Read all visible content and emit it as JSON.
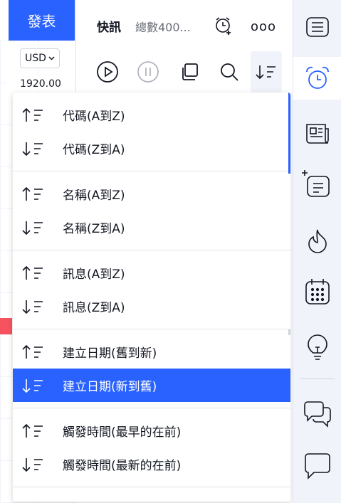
{
  "left": {
    "publish_label": "發表",
    "currency": "USD",
    "price": "1920.00"
  },
  "news": {
    "title": "快訊",
    "count": "總數400...",
    "more_label": "ooo"
  },
  "sort_menu": {
    "groups": [
      [
        {
          "label": "代碼(A到Z)",
          "direction": "asc"
        },
        {
          "label": "代碼(Z到A)",
          "direction": "desc"
        }
      ],
      [
        {
          "label": "名稱(A到Z)",
          "direction": "asc"
        },
        {
          "label": "名稱(Z到A)",
          "direction": "desc"
        }
      ],
      [
        {
          "label": "訊息(A到Z)",
          "direction": "asc"
        },
        {
          "label": "訊息(Z到A)",
          "direction": "desc"
        }
      ],
      [
        {
          "label": "建立日期(舊到新)",
          "direction": "asc"
        },
        {
          "label": "建立日期(新到舊)",
          "direction": "desc",
          "selected": true
        }
      ],
      [
        {
          "label": "觸發時間(最早的在前)",
          "direction": "asc"
        },
        {
          "label": "觸發時間(最新的在前)",
          "direction": "desc"
        }
      ]
    ]
  },
  "colors": {
    "accent": "#2962ff",
    "sidebar_bg": "#f0f3fa",
    "text": "#131722",
    "muted": "#6a6d78",
    "marker_red": "#f7525f"
  },
  "icons": {
    "toolbar": [
      "play-icon",
      "pause-icon",
      "copy-icon",
      "search-icon",
      "sort-descending-icon"
    ],
    "sidebar": [
      "watchlist-icon",
      "alarm-clock-icon",
      "news-icon",
      "add-list-icon",
      "fire-icon",
      "calendar-icon",
      "lightbulb-icon",
      "chat-icon",
      "chat-bubble-icon"
    ]
  }
}
